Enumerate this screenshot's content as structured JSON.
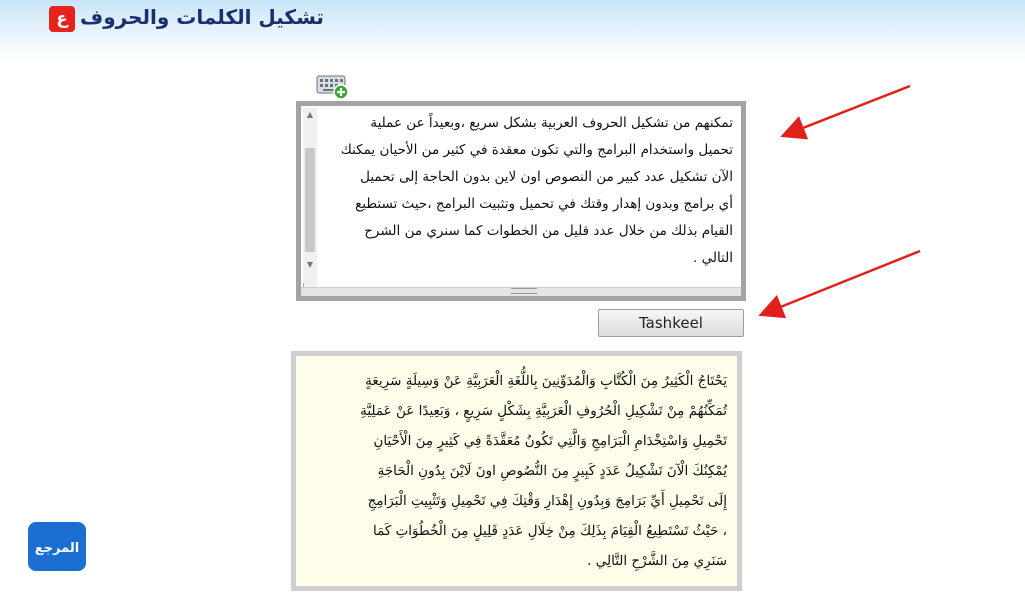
{
  "header": {
    "title": "تشكيل الكلمات والحروف",
    "badge": "ع"
  },
  "input": {
    "lines": [
      "تمكنهم من تشكيل الحروف العربية بشكل سريع ،وبعيداً عن عملية",
      "تحميل واستخدام البرامج والتي تكون معقدة في كثير من الأحيان يمكنك",
      "الآن تشكيل عدد كبير من النصوص اون لاين بدون الحاجة إلى تحميل",
      "أي برامج وبدون إهدار وقتك في تحميل وتثبيت البرامج ،حيث تستطيع",
      "القيام بذلك من خلال عدد قليل من الخطوات كما سنري من الشرح",
      "التالي ."
    ]
  },
  "button": {
    "label": "Tashkeel"
  },
  "output": {
    "lines": [
      "يَحْتَاجُ الْكَثِيرُ مِنَ الْكُتَّابِ وَالْمُدَوِّنِينَ بِاللُّغَةِ الْعَرَبِيَّةِ عَنْ وَسِيلَةٍ سَرِيعَةٍ",
      "تُمَكِّنُهُمْ مِنْ تَشْكِيلِ الْحُرُوفِ الْعَرَبِيَّةِ بِشَكْلٍ سَرِيعٍ ، وَبَعِيدًا عَنْ عَمَلِيَّةِ",
      "تَحْمِيلِ وَاسْتِخْدَامِ الْبَرَامِجِ وَالَّتِي تَكُونُ مُعَقَّدَةً فِي كَثِيرٍ مِنَ الْأَحْيَانِ",
      "يُمْكِنُكَ الْآنَ تَشْكِيلُ عَدَدٍ كَبِيرٍ مِنَ النُّصُوصِ اونَ لَايْنَ بِدُونِ الْحَاجَةِ",
      "إِلَى تَحْمِيلِ أَيِّ بَرَامِجَ وَبِدُونِ إِهْدَارِ وَقْتِكَ فِي تَحْمِيلِ وَتَثْبِيتِ الْبَرَامِجِ",
      "، حَيْثُ تَسْتَطِيعُ الْقِيَامَ بِذَلِكَ مِنْ خِلَالِ عَدَدٍ قَلِيلٍ مِنَ الْخُطُوَاتِ كَمَا",
      "سَنَرِي مِنَ الشَّرْحِ التَّالِي ."
    ]
  },
  "logo": {
    "text": "المرجع"
  },
  "colors": {
    "title": "#1a2f6e",
    "badge": "#e5231b",
    "arrow": "#e0201a",
    "output_bg": "#fdfde9",
    "logo": "#1a6fd0"
  },
  "icons": {
    "keyboard": "keyboard-add-icon",
    "scroll_up": "scroll-up-icon",
    "scroll_down": "scroll-down-icon"
  }
}
